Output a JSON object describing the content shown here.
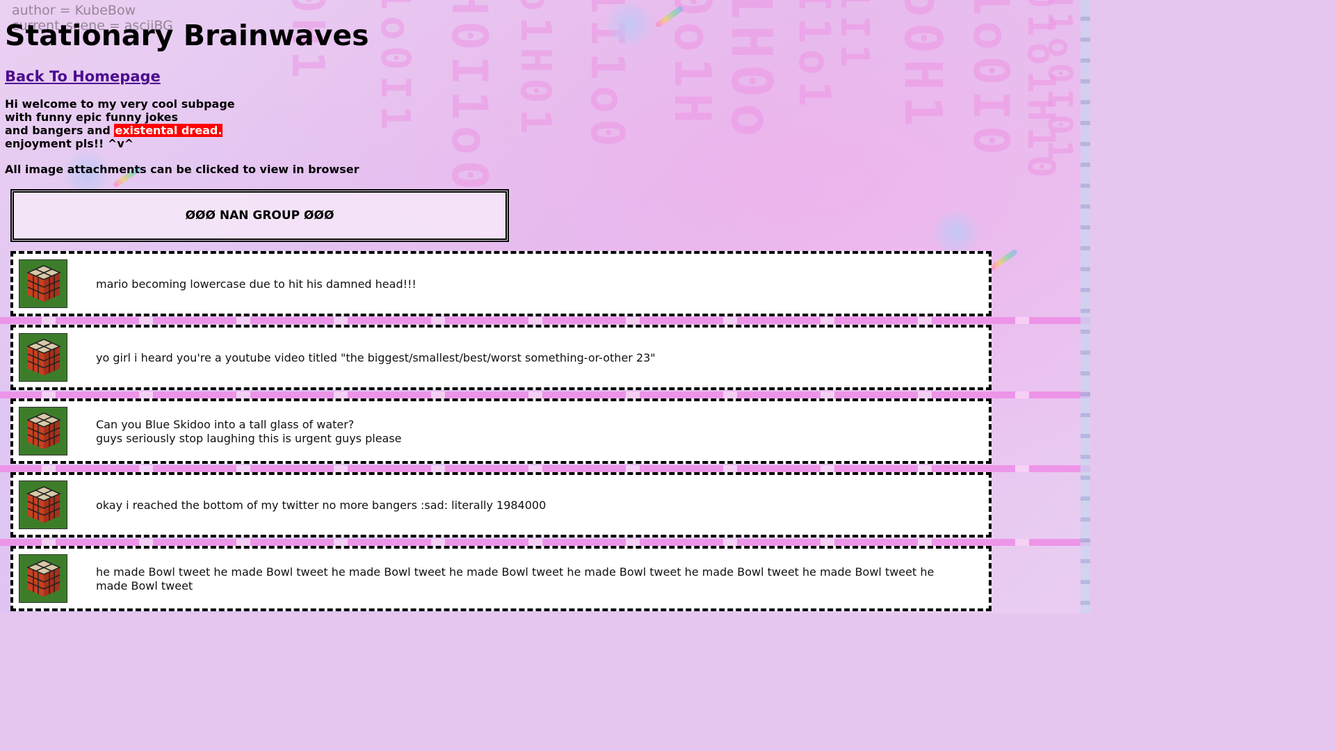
{
  "debug_overlay": {
    "author": "author = KubeBow",
    "scene": "current_scene = asciiBG"
  },
  "page": {
    "title": "Stationary Brainwaves",
    "home_link": "Back To Homepage",
    "intro": {
      "line1": "Hi welcome to my very cool subpage",
      "line2": "with funny epic funny jokes",
      "line3_prefix": "and bangers and",
      "line3_highlight": "existental dread.",
      "line4": "enjoyment pls!! ^v^"
    },
    "attachments_note": "All image attachments can be clicked to view in browser",
    "group_header": "ØØØ NAN GROUP ØØØ"
  },
  "tweets": [
    {
      "lines": [
        "mario becoming lowercase due to hit his damned head!!!"
      ]
    },
    {
      "lines": [
        "yo girl i heard you're a youtube video titled \"the biggest/smallest/best/worst something-or-other 23\""
      ]
    },
    {
      "lines": [
        "Can you Blue Skidoo into a tall glass of water?",
        "guys seriously stop laughing this is urgent guys please"
      ]
    },
    {
      "lines": [
        "okay i reached the bottom of my twitter no more bangers :sad: literally 1984000"
      ]
    },
    {
      "lines": [
        "he made Bowl tweet he made Bowl tweet he made Bowl tweet he made Bowl tweet he made Bowl tweet he made Bowl tweet he made Bowl tweet he made Bowl tweet"
      ]
    }
  ],
  "icons": {
    "avatar": "rubiks-cube-icon"
  },
  "colors": {
    "link": "#4b0e8e",
    "highlight_bg": "#ff0000",
    "highlight_text": "#ffffff",
    "background": "#e6c6ee"
  }
}
